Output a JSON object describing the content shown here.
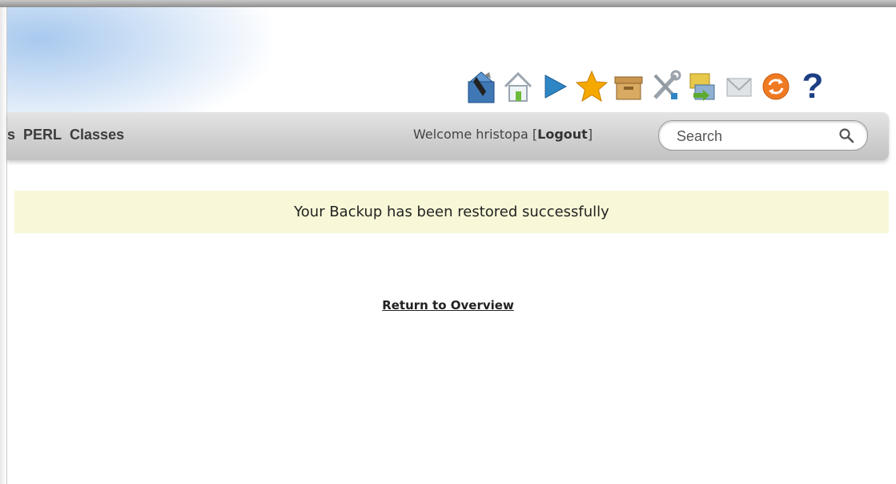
{
  "toolbar": {
    "icons": [
      "builder-icon",
      "home-icon",
      "play-icon",
      "star-icon",
      "box-icon",
      "tools-icon",
      "transfer-icon",
      "mail-icon",
      "refresh-icon",
      "help-icon"
    ],
    "help_glyph": "?"
  },
  "nav": {
    "items": [
      "s",
      "PERL",
      "Classes"
    ]
  },
  "user": {
    "welcome_text": "Welcome hristopa",
    "open_bracket": "[",
    "logout_label": "Logout",
    "close_bracket": "]"
  },
  "search": {
    "placeholder": "Search"
  },
  "notice": {
    "message": "Your Backup has been restored successfully"
  },
  "links": {
    "return_label": "Return to Overview"
  },
  "colors": {
    "notice_bg": "#f8f8d8",
    "navbar": "#d2d2d2",
    "play": "#2f86c4",
    "star": "#f5a800",
    "help": "#1d3f84"
  }
}
